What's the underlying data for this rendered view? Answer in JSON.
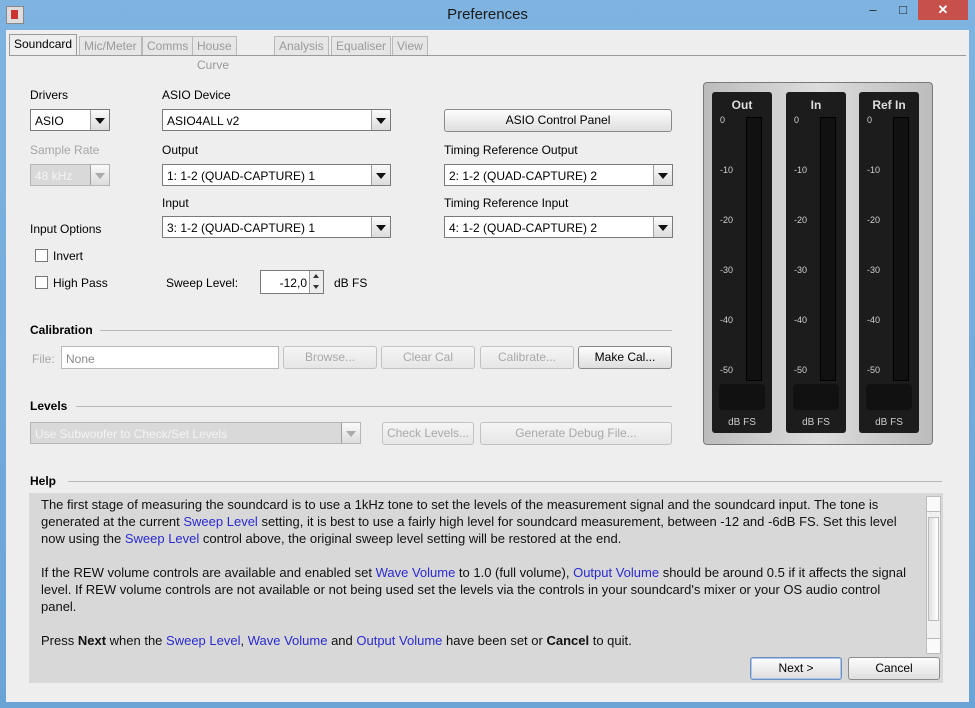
{
  "window": {
    "title": "Preferences",
    "minimize": "–",
    "maximize": "□",
    "close": "✕"
  },
  "tabs": [
    {
      "label": "Soundcard",
      "active": true
    },
    {
      "label": "Mic/Meter",
      "active": false
    },
    {
      "label": "Comms",
      "active": false
    },
    {
      "label": "House Curve",
      "active": false
    },
    {
      "label": "Analysis",
      "active": false
    },
    {
      "label": "Equaliser",
      "active": false
    },
    {
      "label": "View",
      "active": false
    }
  ],
  "drivers": {
    "label": "Drivers",
    "value": "ASIO"
  },
  "sample_rate": {
    "label": "Sample Rate",
    "value": "48 kHz"
  },
  "asio_device": {
    "label": "ASIO Device",
    "value": "ASIO4ALL v2"
  },
  "asio_control_panel": "ASIO Control Panel",
  "output": {
    "label": "Output",
    "value": "1: 1-2 (QUAD-CAPTURE) 1"
  },
  "timing_ref_output": {
    "label": "Timing Reference Output",
    "value": "2: 1-2 (QUAD-CAPTURE) 2"
  },
  "input": {
    "label": "Input",
    "value": "3: 1-2 (QUAD-CAPTURE) 1"
  },
  "timing_ref_input": {
    "label": "Timing Reference Input",
    "value": "4: 1-2 (QUAD-CAPTURE) 2"
  },
  "input_options": {
    "label": "Input Options",
    "invert": "Invert",
    "high_pass": "High Pass",
    "invert_checked": false,
    "high_pass_checked": false
  },
  "sweep": {
    "label": "Sweep Level:",
    "value": "-12,0",
    "unit": "dB FS"
  },
  "calibration": {
    "heading": "Calibration",
    "file_label": "File:",
    "file_value": "None",
    "browse": "Browse...",
    "clear": "Clear Cal",
    "calibrate": "Calibrate...",
    "make": "Make Cal..."
  },
  "levels": {
    "heading": "Levels",
    "combo": "Use Subwoofer to Check/Set Levels",
    "check": "Check Levels...",
    "debug": "Generate Debug File..."
  },
  "meters": {
    "ticks": [
      "0",
      "-10",
      "-20",
      "-30",
      "-40",
      "-50"
    ],
    "unit": "dB FS",
    "channels": [
      {
        "name": "Out"
      },
      {
        "name": "In"
      },
      {
        "name": "Ref In"
      }
    ]
  },
  "help": {
    "heading": "Help",
    "p1_a": "The first stage of measuring the soundcard is to use a 1kHz tone to set the levels of the measurement signal and the soundcard input. The tone is generated at the current ",
    "p1_link1": "Sweep Level",
    "p1_b": " setting, it is best to use a fairly high level for soundcard measurement, between -12 and -6dB FS. Set this level now using the ",
    "p1_link2": "Sweep Level",
    "p1_c": " control above, the original sweep level setting will be restored at the end.",
    "p2_a": "If the REW volume controls are available and enabled set ",
    "p2_link1": "Wave Volume",
    "p2_b": " to 1.0 (full volume), ",
    "p2_link2": "Output Volume",
    "p2_c": " should be around 0.5 if it affects the signal level. If REW volume controls are not available or not being used set the levels via the controls in your soundcard's mixer or your OS audio control panel.",
    "p3_a": "Press ",
    "p3_next": "Next",
    "p3_b": " when the ",
    "p3_link1": "Sweep Level",
    "p3_c": ", ",
    "p3_link2": "Wave Volume",
    "p3_d": " and ",
    "p3_link3": "Output Volume",
    "p3_e": " have been set or ",
    "p3_cancel": "Cancel",
    "p3_f": " to quit."
  },
  "footer": {
    "next": "Next >",
    "cancel": "Cancel"
  }
}
